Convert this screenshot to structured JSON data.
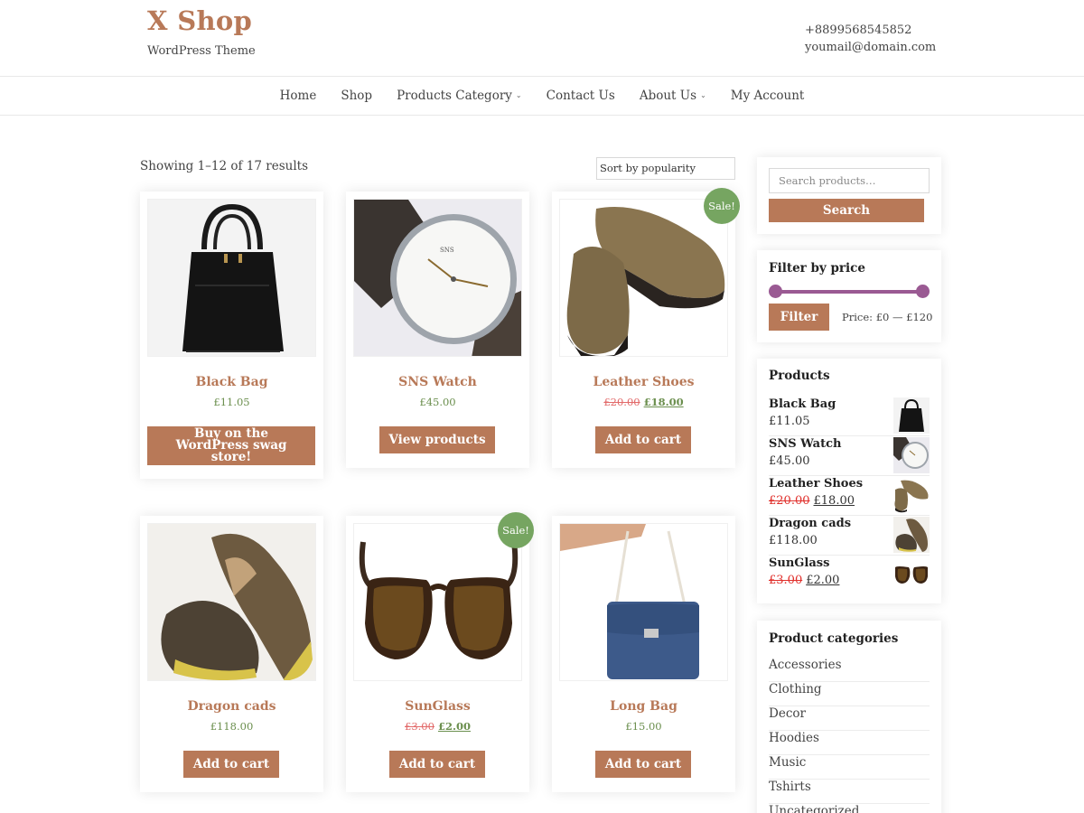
{
  "site": {
    "title": "X Shop",
    "tagline": "WordPress Theme",
    "phone": "+8899568545852",
    "email": "youmail@domain.com"
  },
  "nav": {
    "items": [
      {
        "label": "Home",
        "has_dropdown": false
      },
      {
        "label": "Shop",
        "has_dropdown": false
      },
      {
        "label": "Products Category",
        "has_dropdown": true
      },
      {
        "label": "Contact Us",
        "has_dropdown": false
      },
      {
        "label": "About Us",
        "has_dropdown": true
      },
      {
        "label": "My Account",
        "has_dropdown": false
      }
    ]
  },
  "shop": {
    "result_count": "Showing 1–12 of 17 results",
    "ordering": "Sort by popularity"
  },
  "products": [
    {
      "name": "Black Bag",
      "price": "£11.05",
      "button": "Buy on the WordPress swag store!",
      "image": "black-handbag"
    },
    {
      "name": "SNS Watch",
      "price": "£45.00",
      "button": "View products",
      "image": "wrist-watch"
    },
    {
      "name": "Leather Shoes",
      "old_price": "£20.00",
      "price": "£18.00",
      "sale": "Sale!",
      "button": "Add to cart",
      "image": "suede-shoes"
    },
    {
      "name": "Dragon cads",
      "price": "£118.00",
      "button": "Add to cart",
      "image": "sneakers"
    },
    {
      "name": "SunGlass",
      "old_price": "£3.00",
      "price": "£2.00",
      "sale": "Sale!",
      "button": "Add to cart",
      "image": "sunglasses"
    },
    {
      "name": "Long Bag",
      "price": "£15.00",
      "button": "Add to cart",
      "image": "blue-shoulder-bag"
    }
  ],
  "sidebar": {
    "search": {
      "placeholder": "Search products…",
      "button": "Search"
    },
    "price_filter": {
      "title": "Filter by price",
      "button": "Filter",
      "label": "Price: £0 — £120",
      "min": 0,
      "max": 120
    },
    "products_widget": {
      "title": "Products",
      "items": [
        {
          "name": "Black Bag",
          "price": "£11.05"
        },
        {
          "name": "SNS Watch",
          "price": "£45.00"
        },
        {
          "name": "Leather Shoes",
          "old_price": "£20.00",
          "price": "£18.00"
        },
        {
          "name": "Dragon cads",
          "price": "£118.00"
        },
        {
          "name": "SunGlass",
          "old_price": "£3.00",
          "price": "£2.00"
        }
      ]
    },
    "categories": {
      "title": "Product categories",
      "items": [
        "Accessories",
        "Clothing",
        "Decor",
        "Hoodies",
        "Music",
        "Tshirts",
        "Uncategorized"
      ]
    }
  },
  "colors": {
    "accent": "#b87958",
    "sale_badge": "#76a561",
    "price_green": "#6b8f4e",
    "slider": "#9a5a93",
    "strike_red": "#e26a6a"
  }
}
